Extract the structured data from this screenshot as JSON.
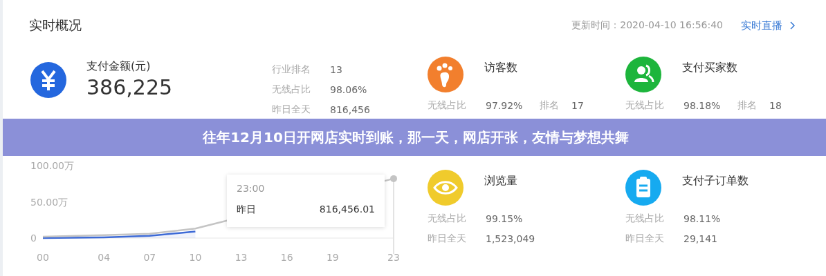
{
  "panel": {
    "title": "实时概况",
    "update_time": "更新时间：2020-04-10 16:56:40",
    "live_link": "实时直播"
  },
  "primary_metric": {
    "name": "支付金额(元)",
    "value": "386,225",
    "stats": [
      {
        "label": "行业排名",
        "value": "13"
      },
      {
        "label": "无线占比",
        "value": "98.06%"
      },
      {
        "label": "昨日全天",
        "value": "816,456"
      }
    ]
  },
  "metrics": [
    {
      "name": "访客数",
      "stats": [
        {
          "label": "无线占比",
          "value": "97.92%",
          "rank_label": "排名",
          "rank": "17"
        }
      ]
    },
    {
      "name": "支付买家数",
      "stats": [
        {
          "label": "无线占比",
          "value": "98.18%",
          "rank_label": "排名",
          "rank": "18"
        }
      ]
    },
    {
      "name": "浏览量",
      "stats": [
        {
          "label": "无线占比",
          "value": "99.15%"
        },
        {
          "label": "昨日全天",
          "value": "1,523,049"
        }
      ]
    },
    {
      "name": "支付子订单数",
      "stats": [
        {
          "label": "无线占比",
          "value": "98.11%"
        },
        {
          "label": "昨日全天",
          "value": "29,141"
        }
      ]
    }
  ],
  "chart": {
    "tooltip": {
      "time": "23:00",
      "series": "昨日",
      "value": "816,456.01"
    },
    "chart_data": {
      "type": "line",
      "x": [
        0,
        4,
        7,
        10,
        23
      ],
      "xlim": [
        0,
        23
      ],
      "xticks": [
        {
          "value": 0,
          "label": "00"
        },
        {
          "value": 4,
          "label": "04"
        },
        {
          "value": 7,
          "label": "07"
        },
        {
          "value": 10,
          "label": "10"
        },
        {
          "value": 13,
          "label": "13"
        },
        {
          "value": 16,
          "label": "16"
        },
        {
          "value": 19,
          "label": "19"
        },
        {
          "value": 23,
          "label": "23"
        }
      ],
      "yticks": [
        {
          "value": 0,
          "label": "0"
        },
        {
          "value": 50,
          "label": "50.00万"
        },
        {
          "value": 100,
          "label": "100.00万"
        }
      ],
      "ylim": [
        0,
        100
      ],
      "series": [
        {
          "color": "#3d6ad6",
          "values": [
            0,
            1,
            3,
            9,
            null
          ]
        },
        {
          "color": "#c4c4c4",
          "values": [
            2,
            4,
            6,
            13,
            82
          ]
        }
      ]
    }
  },
  "banner": {
    "title": "往年12月10日开网店实时到账，那一天，网店开张，友情与梦想共舞"
  }
}
